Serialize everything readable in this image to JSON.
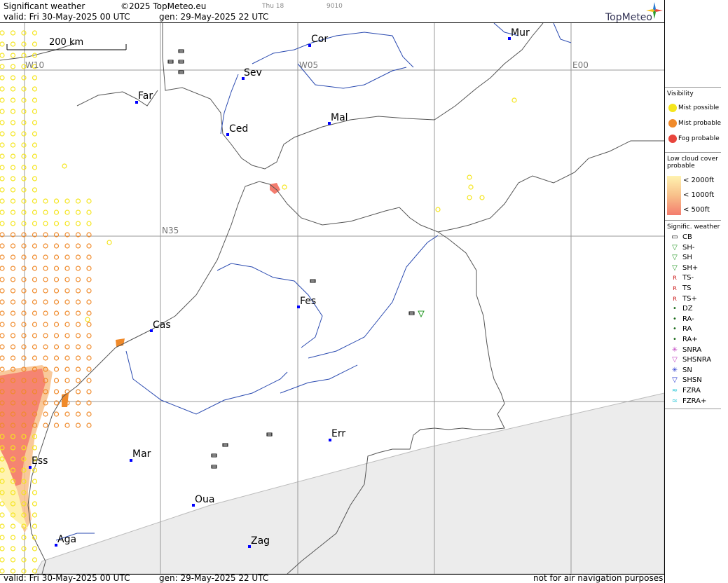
{
  "header": {
    "title": "Significant weather",
    "copyright": "©2025 TopMeteo.eu",
    "faint_day": "Thu 18",
    "faint_code": "9010",
    "valid_line": "valid:  Fri  30-May-2025  00 UTC",
    "gen_line": "gen: 29-May-2025 22 UTC",
    "logo": "TopMeteo"
  },
  "footer": {
    "valid_line": "valid:  Fri  30-May-2025  00 UTC",
    "gen_line": "gen: 29-May-2025 22 UTC",
    "disclaimer": "not for air navigation purposes"
  },
  "map": {
    "scale_label": "200 km",
    "grid_labels": [
      "W10",
      "W05",
      "E00",
      "N35"
    ],
    "cities": [
      "Cor",
      "Mur",
      "Sev",
      "Far",
      "Mal",
      "Ced",
      "Fes",
      "Cas",
      "Err",
      "Mar",
      "Ess",
      "Oua",
      "Aga",
      "Zag"
    ]
  },
  "legend": {
    "visibility_title": "Visibility",
    "visibility": [
      "Mist possible",
      "Mist probable",
      "Fog probable"
    ],
    "low_cloud_title": "Low cloud cover probable",
    "low_cloud": [
      "< 2000ft",
      "< 1000ft",
      "<   500ft"
    ],
    "sigwx_title": "Signific. weather",
    "sigwx": [
      "CB",
      "SH-",
      "SH",
      "SH+",
      "TS-",
      "TS",
      "TS+",
      "DZ",
      "RA-",
      "RA",
      "RA+",
      "SNRA",
      "SHSNRA",
      "SN",
      "SHSN",
      "FZRA",
      "FZRA+"
    ],
    "colors": {
      "mist_possible": "#f5e51c",
      "mist_probable": "#f08a2a",
      "fog_probable": "#e8453c",
      "cloud_2000": "#fff3b0",
      "cloud_1000": "#f8c08a",
      "cloud_500": "#f47c6e",
      "ts": "#d03030",
      "sh": "#2a9a2a",
      "ra": "#1a6a1a",
      "sn": "#2a3ad0",
      "snra": "#c040c0",
      "fzra": "#30c8d8",
      "city": "#0000ff"
    }
  }
}
